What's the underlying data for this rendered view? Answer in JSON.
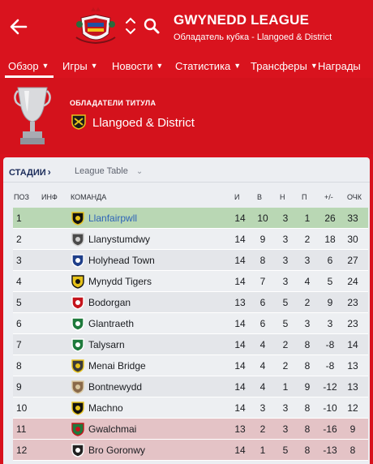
{
  "header": {
    "title": "GWYNEDD LEAGUE",
    "subtitle": "Обладатель кубка - Llangoed & District"
  },
  "nav": {
    "tabs": [
      {
        "label": "Обзор",
        "active": true
      },
      {
        "label": "Игры"
      },
      {
        "label": "Новости"
      },
      {
        "label": "Статистика"
      },
      {
        "label": "Трансферы"
      },
      {
        "label": "Награды"
      }
    ]
  },
  "holders": {
    "label": "ОБЛАДАТЕЛИ ТИТУЛА",
    "team": "Llangoed & District"
  },
  "panel": {
    "stages_label": "СТАДИИ",
    "table_select": "League Table"
  },
  "table": {
    "columns": {
      "pos": "ПОЗ",
      "info": "ИНФ",
      "team": "КОМАНДА",
      "played": "И",
      "won": "В",
      "drawn": "Н",
      "lost": "П",
      "gd": "+/-",
      "pts": "ОЧК"
    },
    "rows": [
      {
        "pos": "1",
        "team": "Llanfairpwll",
        "played": "14",
        "won": "10",
        "drawn": "3",
        "lost": "1",
        "gd": "26",
        "pts": "33"
      },
      {
        "pos": "2",
        "team": "Llanystumdwy",
        "played": "14",
        "won": "9",
        "drawn": "3",
        "lost": "2",
        "gd": "18",
        "pts": "30"
      },
      {
        "pos": "3",
        "team": "Holyhead Town",
        "played": "14",
        "won": "8",
        "drawn": "3",
        "lost": "3",
        "gd": "6",
        "pts": "27"
      },
      {
        "pos": "4",
        "team": "Mynydd Tigers",
        "played": "14",
        "won": "7",
        "drawn": "3",
        "lost": "4",
        "gd": "5",
        "pts": "24"
      },
      {
        "pos": "5",
        "team": "Bodorgan",
        "played": "13",
        "won": "6",
        "drawn": "5",
        "lost": "2",
        "gd": "9",
        "pts": "23"
      },
      {
        "pos": "6",
        "team": "Glantraeth",
        "played": "14",
        "won": "6",
        "drawn": "5",
        "lost": "3",
        "gd": "3",
        "pts": "23"
      },
      {
        "pos": "7",
        "team": "Talysarn",
        "played": "14",
        "won": "4",
        "drawn": "2",
        "lost": "8",
        "gd": "-8",
        "pts": "14"
      },
      {
        "pos": "8",
        "team": "Menai Bridge",
        "played": "14",
        "won": "4",
        "drawn": "2",
        "lost": "8",
        "gd": "-8",
        "pts": "13"
      },
      {
        "pos": "9",
        "team": "Bontnewydd",
        "played": "14",
        "won": "4",
        "drawn": "1",
        "lost": "9",
        "gd": "-12",
        "pts": "13"
      },
      {
        "pos": "10",
        "team": "Machno",
        "played": "14",
        "won": "3",
        "drawn": "3",
        "lost": "8",
        "gd": "-10",
        "pts": "12"
      },
      {
        "pos": "11",
        "team": "Gwalchmai",
        "played": "13",
        "won": "2",
        "drawn": "3",
        "lost": "8",
        "gd": "-16",
        "pts": "9"
      },
      {
        "pos": "12",
        "team": "Bro Goronwy",
        "played": "14",
        "won": "1",
        "drawn": "5",
        "lost": "8",
        "gd": "-13",
        "pts": "8"
      }
    ]
  },
  "colors": {
    "brand_red": "#d9131e",
    "champion_row": "#b9d7b4",
    "relegation_row": "#e4c3c6",
    "link_blue": "#2d63b8"
  },
  "icons": [
    "back-arrow-icon",
    "league-crest-icon",
    "chevron-up-icon",
    "chevron-down-icon",
    "search-icon",
    "trophy-icon",
    "club-badge-icon"
  ]
}
